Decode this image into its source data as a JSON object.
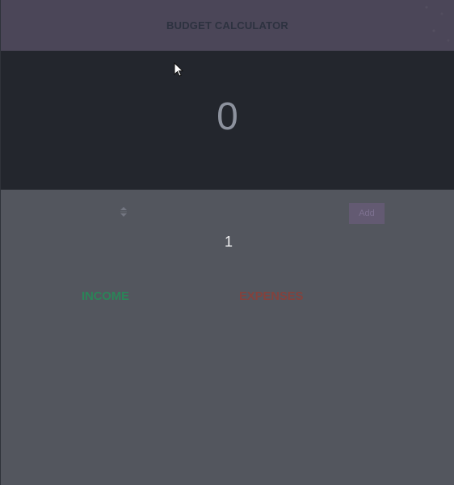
{
  "header": {
    "title": "BUDGET CALCULATOR"
  },
  "summary": {
    "balance": "0",
    "count": "1"
  },
  "form": {
    "add_label": "Add"
  },
  "sections": {
    "income_title": "INCOME",
    "expenses_title": "EXPENSES"
  },
  "colors": {
    "header_bg": "#4b4658",
    "balance_panel_bg": "#23262d",
    "main_bg": "#53565e",
    "income": "#2b8458",
    "expenses": "#83423d",
    "button_bg": "#635a72"
  },
  "icons": {
    "pointer": "arrow-cursor-icon",
    "stepper": "number-stepper-icon"
  }
}
